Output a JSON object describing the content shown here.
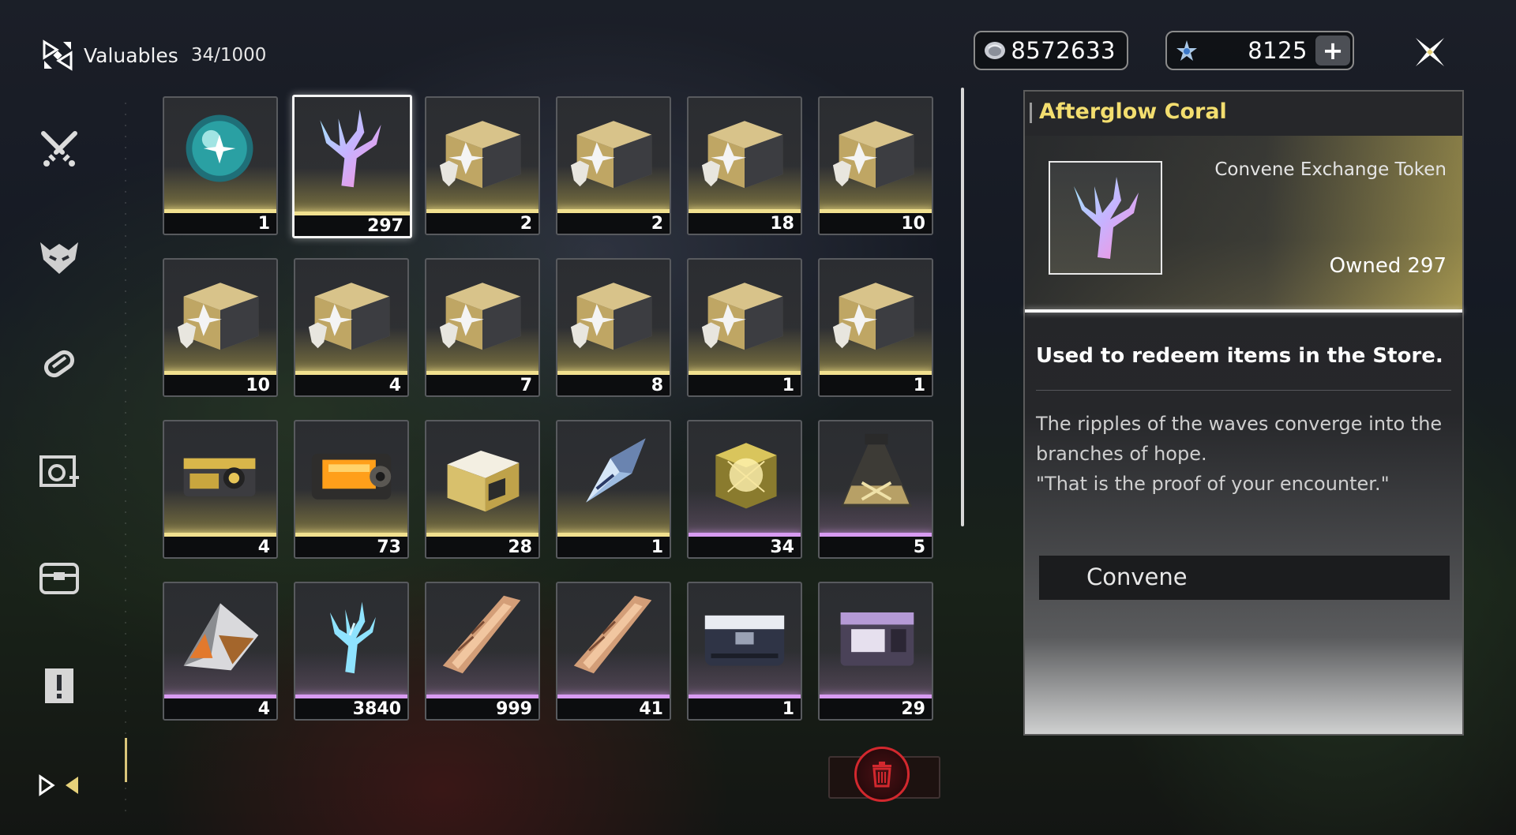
{
  "header": {
    "title": "Valuables",
    "count": "34/1000",
    "icon": "inventory-logo-icon"
  },
  "currencies": [
    {
      "icon": "shell-credit-icon",
      "value": "8572633"
    },
    {
      "icon": "astrite-star-icon",
      "value": "8125",
      "add_label": "+"
    }
  ],
  "sidebar": {
    "items": [
      {
        "icon": "weapon-swords-icon"
      },
      {
        "icon": "echo-mask-icon"
      },
      {
        "icon": "upgrade-material-icon"
      },
      {
        "icon": "development-material-icon"
      },
      {
        "icon": "resource-chest-icon"
      },
      {
        "icon": "quest-item-icon"
      },
      {
        "icon": "valuables-icon",
        "selected": true
      }
    ]
  },
  "items": [
    {
      "id": "orb",
      "rarity": "gold",
      "qty": "1"
    },
    {
      "id": "afterglow-coral",
      "rarity": "gold",
      "qty": "297",
      "selected": true
    },
    {
      "id": "supply-chest",
      "rarity": "gold",
      "qty": "2"
    },
    {
      "id": "supply-chest",
      "rarity": "gold",
      "qty": "2"
    },
    {
      "id": "supply-chest",
      "rarity": "gold",
      "qty": "18"
    },
    {
      "id": "supply-chest",
      "rarity": "gold",
      "qty": "10"
    },
    {
      "id": "supply-chest",
      "rarity": "gold",
      "qty": "10"
    },
    {
      "id": "supply-chest",
      "rarity": "gold",
      "qty": "4"
    },
    {
      "id": "supply-chest",
      "rarity": "gold",
      "qty": "7"
    },
    {
      "id": "supply-chest",
      "rarity": "gold",
      "qty": "8"
    },
    {
      "id": "supply-chest",
      "rarity": "gold",
      "qty": "1"
    },
    {
      "id": "supply-chest",
      "rarity": "gold",
      "qty": "1"
    },
    {
      "id": "gold-device",
      "rarity": "gold",
      "qty": "4"
    },
    {
      "id": "orange-crate",
      "rarity": "gold",
      "qty": "73"
    },
    {
      "id": "open-gold-box",
      "rarity": "gold",
      "qty": "28"
    },
    {
      "id": "crystal-shard",
      "rarity": "gold",
      "qty": "1"
    },
    {
      "id": "gold-cube",
      "rarity": "purple",
      "qty": "34"
    },
    {
      "id": "flask",
      "rarity": "purple",
      "qty": "5"
    },
    {
      "id": "triangle-module",
      "rarity": "purple",
      "qty": "4"
    },
    {
      "id": "oscillated-coral",
      "rarity": "purple",
      "qty": "3840"
    },
    {
      "id": "copper-blade",
      "rarity": "purple",
      "qty": "999"
    },
    {
      "id": "copper-blade",
      "rarity": "purple",
      "qty": "41"
    },
    {
      "id": "dark-case",
      "rarity": "purple",
      "qty": "1"
    },
    {
      "id": "purple-case",
      "rarity": "purple",
      "qty": "29"
    }
  ],
  "detail": {
    "name": "Afterglow Coral",
    "type": "Convene Exchange Token",
    "owned_label": "Owned",
    "owned_value": "297",
    "short_desc": "Used to redeem items in the Store.",
    "description": "The ripples of the waves converge into the branches of hope.\n\"That is the proof of your encounter.\"",
    "action_label": "Convene"
  },
  "colors": {
    "title_accent": "#f3de6f",
    "gold_rarity": "#f1e08f",
    "purple_rarity": "#d89bf2",
    "delete_red": "#d2282e"
  }
}
